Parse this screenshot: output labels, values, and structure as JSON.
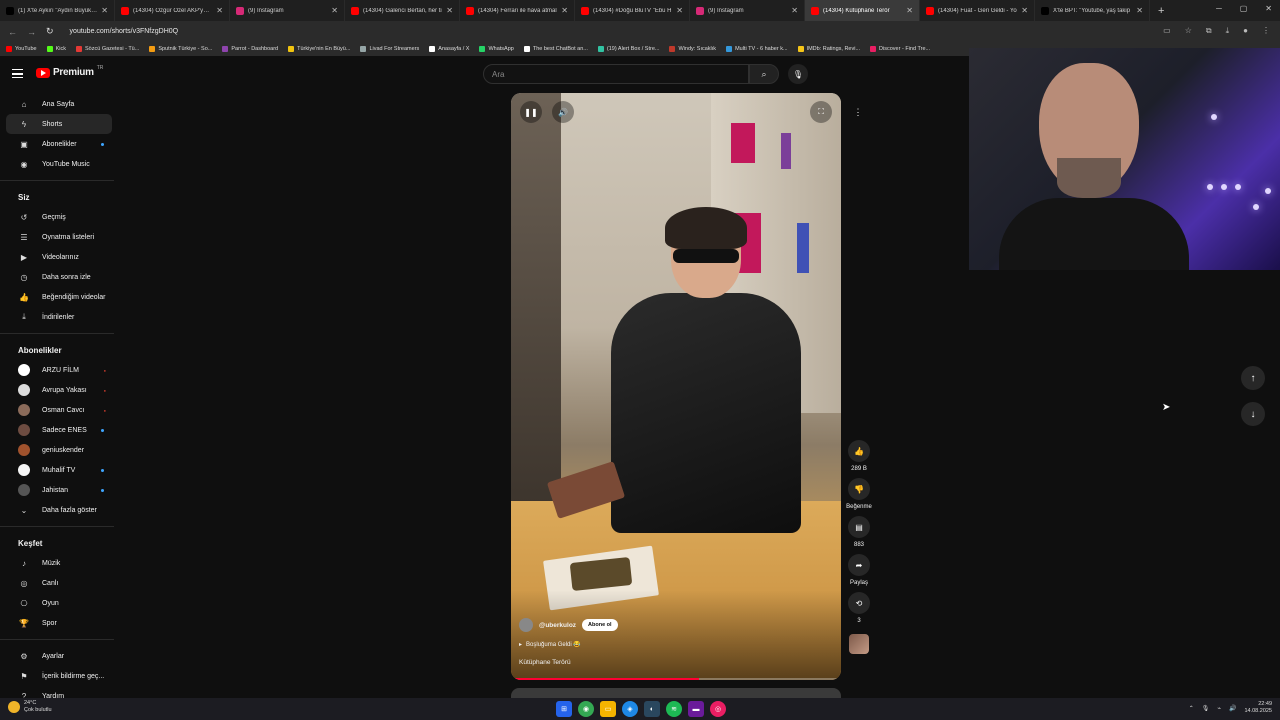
{
  "browser": {
    "tabs": [
      {
        "title": "(1) X'te Aykırı \"Aydın Büyükşe",
        "color": "#000000",
        "active": false
      },
      {
        "title": "(14304) Özgür Özel AKP'ye 'o",
        "color": "#ff0000",
        "active": false
      },
      {
        "title": "(9) Instagram",
        "color": "#d62976",
        "active": false
      },
      {
        "title": "(14304) Galerici Bertan, her ti",
        "color": "#ff0000",
        "active": false
      },
      {
        "title": "(14304) Ferrari ile hava atmal",
        "color": "#ff0000",
        "active": false
      },
      {
        "title": "(14304) #Doğu BluTV \"Ebu H",
        "color": "#ff0000",
        "active": false
      },
      {
        "title": "(9) Instagram",
        "color": "#d62976",
        "active": false
      },
      {
        "title": "(14304) Kütüphane Terör",
        "color": "#ff0000",
        "active": true
      },
      {
        "title": "(14304) Fuat - Geri Geldi - Yo",
        "color": "#ff0000",
        "active": false
      },
      {
        "title": "X'te BPT: \"Youtube, yaş takip",
        "color": "#000000",
        "active": false
      }
    ],
    "url": "youtube.com/shorts/v3FNfzgDH0Q",
    "bookmarks": [
      {
        "label": "YouTube",
        "color": "#ff0000"
      },
      {
        "label": "Kick",
        "color": "#53fc18"
      },
      {
        "label": "Sözcü Gazetesi - Tü...",
        "color": "#e53935"
      },
      {
        "label": "Sputnik Türkiye - So...",
        "color": "#f39c12"
      },
      {
        "label": "Parrot - Dashboard",
        "color": "#8e44ad"
      },
      {
        "label": "Türkiye'nin En Büyü...",
        "color": "#f1c40f"
      },
      {
        "label": "Livad For Streamers",
        "color": "#95a5a6"
      },
      {
        "label": "Anasayfa / X",
        "color": "#ffffff"
      },
      {
        "label": "WhatsApp",
        "color": "#25d366"
      },
      {
        "label": "The best ChatBot an...",
        "color": "#ffffff"
      },
      {
        "label": "(19) Alert Box / Stre...",
        "color": "#31c3a2"
      },
      {
        "label": "Windy: Sıcaklık",
        "color": "#c0392b"
      },
      {
        "label": "Multi TV - 6 haber k...",
        "color": "#3498db"
      },
      {
        "label": "IMDb: Ratings, Revi...",
        "color": "#f5c518"
      },
      {
        "label": "Discover - Find Tre...",
        "color": "#e91e63"
      }
    ]
  },
  "youtube": {
    "logo_text": "Premium",
    "logo_sup": "TR",
    "search_placeholder": "Ara",
    "sidebar": {
      "main": [
        {
          "label": "Ana Sayfa",
          "icon": "home-icon",
          "glyph": "⌂"
        },
        {
          "label": "Shorts",
          "icon": "shorts-icon",
          "glyph": "ϟ",
          "active": true
        },
        {
          "label": "Abonelikler",
          "icon": "subscriptions-icon",
          "glyph": "▣",
          "dot": true
        },
        {
          "label": "YouTube Music",
          "icon": "music-icon",
          "glyph": "◉"
        }
      ],
      "you_heading": "Siz",
      "you": [
        {
          "label": "Geçmiş",
          "icon": "history-icon",
          "glyph": "↺"
        },
        {
          "label": "Oynatma listeleri",
          "icon": "playlists-icon",
          "glyph": "☰"
        },
        {
          "label": "Videolarınız",
          "icon": "your-videos-icon",
          "glyph": "▶"
        },
        {
          "label": "Daha sonra izle",
          "icon": "watch-later-icon",
          "glyph": "◷"
        },
        {
          "label": "Beğendiğim videolar",
          "icon": "liked-icon",
          "glyph": "👍"
        },
        {
          "label": "İndirilenler",
          "icon": "downloads-icon",
          "glyph": "⤓"
        }
      ],
      "subs_heading": "Abonelikler",
      "subs": [
        {
          "label": "ARZU FİLM",
          "color": "#ffffff",
          "live": true
        },
        {
          "label": "Avrupa Yakası",
          "color": "#dcdcdc",
          "live": true
        },
        {
          "label": "Osman Cavcı",
          "color": "#8b6b5a",
          "live": true
        },
        {
          "label": "Sadece ENES",
          "color": "#6d4c41",
          "dot": true
        },
        {
          "label": "geniuskender",
          "color": "#a0522d"
        },
        {
          "label": "Muhalif TV",
          "color": "#f5f5f5",
          "dot": true
        },
        {
          "label": "Jahistan",
          "color": "#555555",
          "dot": true
        }
      ],
      "show_more": "Daha fazla göster",
      "explore_heading": "Keşfet",
      "explore": [
        {
          "label": "Müzik",
          "icon": "music-note-icon",
          "glyph": "♪"
        },
        {
          "label": "Canlı",
          "icon": "live-icon",
          "glyph": "◎"
        },
        {
          "label": "Oyun",
          "icon": "gaming-icon",
          "glyph": "⎔"
        },
        {
          "label": "Spor",
          "icon": "sports-icon",
          "glyph": "🏆"
        }
      ],
      "settings": [
        {
          "label": "Ayarlar",
          "icon": "settings-icon",
          "glyph": "⚙"
        },
        {
          "label": "İçerik bildirme geç...",
          "icon": "flag-icon",
          "glyph": "⚑"
        },
        {
          "label": "Yardım",
          "icon": "help-icon",
          "glyph": "?"
        }
      ]
    },
    "short": {
      "channel": "@uberkuloz",
      "subscribe_label": "Abone ol",
      "song": "Boşluğuma Geldi 😂",
      "title": "Kütüphane Terörü",
      "progress": 0.57,
      "likes": "289 B",
      "dislike_label": "Beğenme",
      "comments": "883",
      "share_label": "Paylaş",
      "remix_count": "3"
    }
  },
  "taskbar": {
    "weather_temp": "24°C",
    "weather_desc": "Çok bulutlu",
    "time": "22:49",
    "date": "14.08.2025"
  }
}
